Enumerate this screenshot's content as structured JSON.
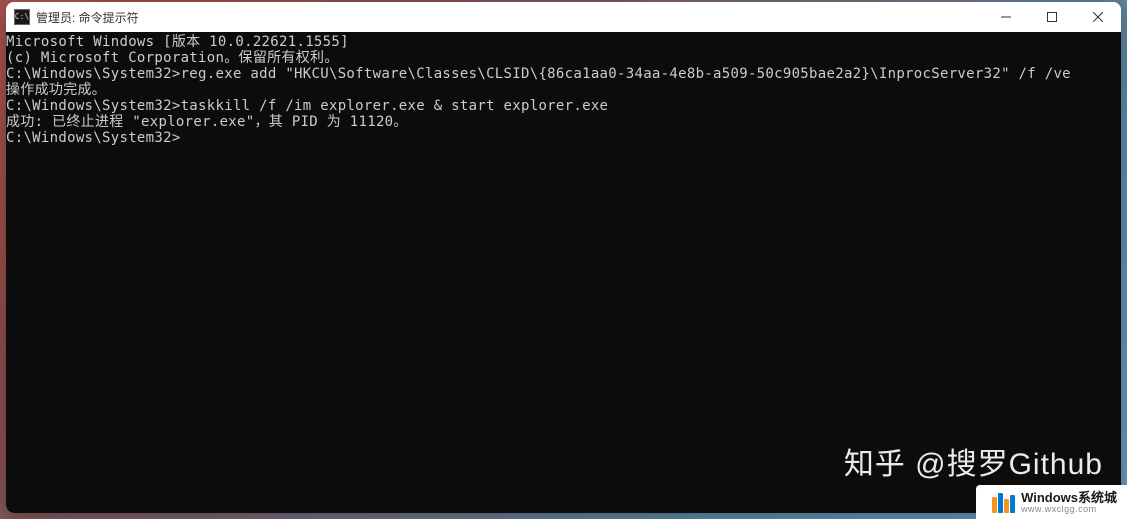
{
  "window": {
    "title": "管理员: 命令提示符",
    "icon_label": "C:\\"
  },
  "terminal": {
    "lines": [
      "Microsoft Windows [版本 10.0.22621.1555]",
      "(c) Microsoft Corporation。保留所有权利。",
      "",
      "C:\\Windows\\System32>reg.exe add \"HKCU\\Software\\Classes\\CLSID\\{86ca1aa0-34aa-4e8b-a509-50c905bae2a2}\\InprocServer32\" /f /ve",
      "操作成功完成。",
      "",
      "C:\\Windows\\System32>taskkill /f /im explorer.exe & start explorer.exe",
      "成功: 已终止进程 \"explorer.exe\"，其 PID 为 11120。",
      "",
      "C:\\Windows\\System32>"
    ]
  },
  "watermark": {
    "text": "知乎 @搜罗Github"
  },
  "corner_badge": {
    "main": "Windows系统城",
    "sub": "www.wxclgg.com"
  }
}
